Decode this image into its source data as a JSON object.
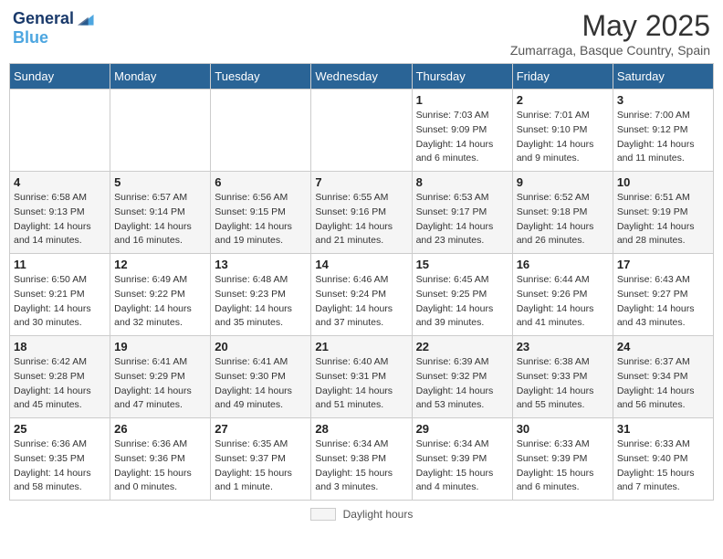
{
  "header": {
    "logo_line1": "General",
    "logo_line2": "Blue",
    "month": "May 2025",
    "location": "Zumarraga, Basque Country, Spain"
  },
  "weekdays": [
    "Sunday",
    "Monday",
    "Tuesday",
    "Wednesday",
    "Thursday",
    "Friday",
    "Saturday"
  ],
  "weeks": [
    [
      {
        "day": "",
        "detail": ""
      },
      {
        "day": "",
        "detail": ""
      },
      {
        "day": "",
        "detail": ""
      },
      {
        "day": "",
        "detail": ""
      },
      {
        "day": "1",
        "detail": "Sunrise: 7:03 AM\nSunset: 9:09 PM\nDaylight: 14 hours\nand 6 minutes."
      },
      {
        "day": "2",
        "detail": "Sunrise: 7:01 AM\nSunset: 9:10 PM\nDaylight: 14 hours\nand 9 minutes."
      },
      {
        "day": "3",
        "detail": "Sunrise: 7:00 AM\nSunset: 9:12 PM\nDaylight: 14 hours\nand 11 minutes."
      }
    ],
    [
      {
        "day": "4",
        "detail": "Sunrise: 6:58 AM\nSunset: 9:13 PM\nDaylight: 14 hours\nand 14 minutes."
      },
      {
        "day": "5",
        "detail": "Sunrise: 6:57 AM\nSunset: 9:14 PM\nDaylight: 14 hours\nand 16 minutes."
      },
      {
        "day": "6",
        "detail": "Sunrise: 6:56 AM\nSunset: 9:15 PM\nDaylight: 14 hours\nand 19 minutes."
      },
      {
        "day": "7",
        "detail": "Sunrise: 6:55 AM\nSunset: 9:16 PM\nDaylight: 14 hours\nand 21 minutes."
      },
      {
        "day": "8",
        "detail": "Sunrise: 6:53 AM\nSunset: 9:17 PM\nDaylight: 14 hours\nand 23 minutes."
      },
      {
        "day": "9",
        "detail": "Sunrise: 6:52 AM\nSunset: 9:18 PM\nDaylight: 14 hours\nand 26 minutes."
      },
      {
        "day": "10",
        "detail": "Sunrise: 6:51 AM\nSunset: 9:19 PM\nDaylight: 14 hours\nand 28 minutes."
      }
    ],
    [
      {
        "day": "11",
        "detail": "Sunrise: 6:50 AM\nSunset: 9:21 PM\nDaylight: 14 hours\nand 30 minutes."
      },
      {
        "day": "12",
        "detail": "Sunrise: 6:49 AM\nSunset: 9:22 PM\nDaylight: 14 hours\nand 32 minutes."
      },
      {
        "day": "13",
        "detail": "Sunrise: 6:48 AM\nSunset: 9:23 PM\nDaylight: 14 hours\nand 35 minutes."
      },
      {
        "day": "14",
        "detail": "Sunrise: 6:46 AM\nSunset: 9:24 PM\nDaylight: 14 hours\nand 37 minutes."
      },
      {
        "day": "15",
        "detail": "Sunrise: 6:45 AM\nSunset: 9:25 PM\nDaylight: 14 hours\nand 39 minutes."
      },
      {
        "day": "16",
        "detail": "Sunrise: 6:44 AM\nSunset: 9:26 PM\nDaylight: 14 hours\nand 41 minutes."
      },
      {
        "day": "17",
        "detail": "Sunrise: 6:43 AM\nSunset: 9:27 PM\nDaylight: 14 hours\nand 43 minutes."
      }
    ],
    [
      {
        "day": "18",
        "detail": "Sunrise: 6:42 AM\nSunset: 9:28 PM\nDaylight: 14 hours\nand 45 minutes."
      },
      {
        "day": "19",
        "detail": "Sunrise: 6:41 AM\nSunset: 9:29 PM\nDaylight: 14 hours\nand 47 minutes."
      },
      {
        "day": "20",
        "detail": "Sunrise: 6:41 AM\nSunset: 9:30 PM\nDaylight: 14 hours\nand 49 minutes."
      },
      {
        "day": "21",
        "detail": "Sunrise: 6:40 AM\nSunset: 9:31 PM\nDaylight: 14 hours\nand 51 minutes."
      },
      {
        "day": "22",
        "detail": "Sunrise: 6:39 AM\nSunset: 9:32 PM\nDaylight: 14 hours\nand 53 minutes."
      },
      {
        "day": "23",
        "detail": "Sunrise: 6:38 AM\nSunset: 9:33 PM\nDaylight: 14 hours\nand 55 minutes."
      },
      {
        "day": "24",
        "detail": "Sunrise: 6:37 AM\nSunset: 9:34 PM\nDaylight: 14 hours\nand 56 minutes."
      }
    ],
    [
      {
        "day": "25",
        "detail": "Sunrise: 6:36 AM\nSunset: 9:35 PM\nDaylight: 14 hours\nand 58 minutes."
      },
      {
        "day": "26",
        "detail": "Sunrise: 6:36 AM\nSunset: 9:36 PM\nDaylight: 15 hours\nand 0 minutes."
      },
      {
        "day": "27",
        "detail": "Sunrise: 6:35 AM\nSunset: 9:37 PM\nDaylight: 15 hours\nand 1 minute."
      },
      {
        "day": "28",
        "detail": "Sunrise: 6:34 AM\nSunset: 9:38 PM\nDaylight: 15 hours\nand 3 minutes."
      },
      {
        "day": "29",
        "detail": "Sunrise: 6:34 AM\nSunset: 9:39 PM\nDaylight: 15 hours\nand 4 minutes."
      },
      {
        "day": "30",
        "detail": "Sunrise: 6:33 AM\nSunset: 9:39 PM\nDaylight: 15 hours\nand 6 minutes."
      },
      {
        "day": "31",
        "detail": "Sunrise: 6:33 AM\nSunset: 9:40 PM\nDaylight: 15 hours\nand 7 minutes."
      }
    ]
  ],
  "footer": {
    "swatch_label": "Daylight hours"
  }
}
